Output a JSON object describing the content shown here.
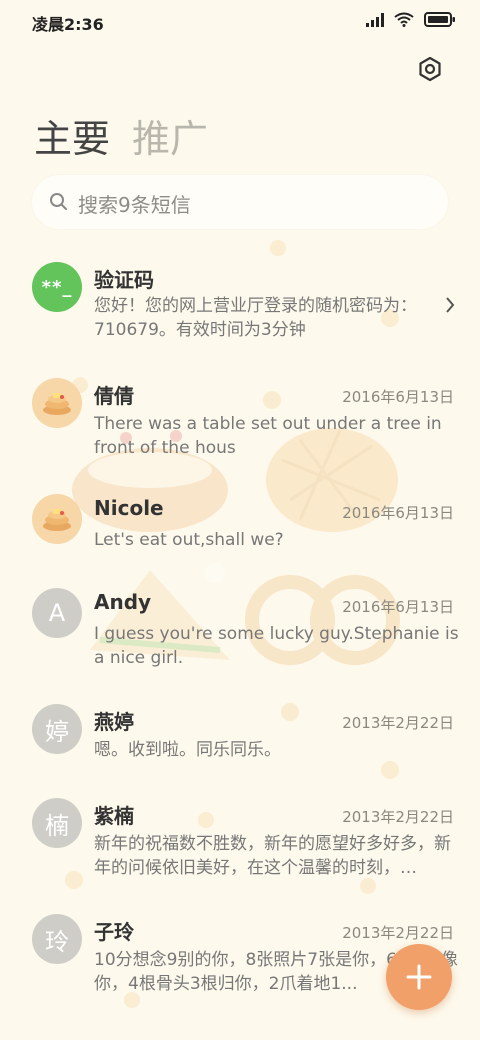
{
  "status_bar": {
    "time": "凌晨2:36"
  },
  "tabs": [
    {
      "label": "主要",
      "active": true
    },
    {
      "label": "推广",
      "active": false
    }
  ],
  "search": {
    "placeholder": "搜索9条短信"
  },
  "conversations": [
    {
      "name": "验证码",
      "avatar": "**_",
      "date": "",
      "preview": "您好！您的网上营业厅登录的随机密码为：710679。有效时间为3分钟"
    },
    {
      "name": "倩倩",
      "avatar": "bread",
      "date": "2016年6月13日",
      "preview": "There was a table set out under a tree in front of the hous"
    },
    {
      "name": "Nicole",
      "avatar": "bread",
      "date": "2016年6月13日",
      "preview": "Let's eat out,shall we?"
    },
    {
      "name": "Andy",
      "avatar": "A",
      "date": "2016年6月13日",
      "preview": "I guess you're some lucky guy.Stephanie is a nice girl."
    },
    {
      "name": "燕婷",
      "avatar": "婷",
      "date": "2013年2月22日",
      "preview": "嗯。收到啦。同乐同乐。"
    },
    {
      "name": "紫楠",
      "avatar": "楠",
      "date": "2013年2月22日",
      "preview": "新年的祝福数不胜数，新年的愿望好多好多，新年的问候依旧美好，在这个温馨的时刻，…"
    },
    {
      "name": "子玲",
      "avatar": "玲",
      "date": "2013年2月22日",
      "preview": "10分想念9别的你，8张照片7张是你，6...5只像你，4根骨头3根归你，2爪着地1..."
    }
  ],
  "colors": {
    "background": "#fdf9ec",
    "fab": "#f2a06a",
    "code_avatar": "#62c45a"
  }
}
